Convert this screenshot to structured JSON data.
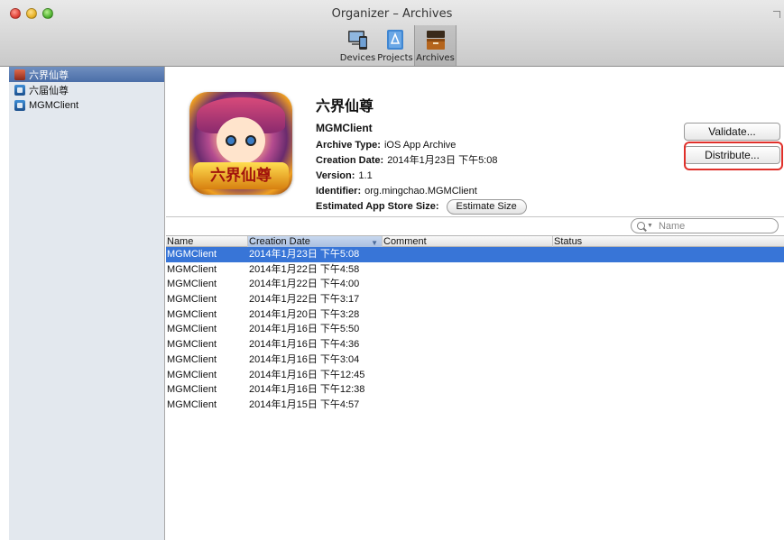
{
  "window": {
    "title": "Organizer – Archives",
    "toolbar": [
      {
        "label": "Devices",
        "icon": "devices-icon"
      },
      {
        "label": "Projects",
        "icon": "projects-icon"
      },
      {
        "label": "Archives",
        "icon": "archives-icon",
        "selected": true
      }
    ]
  },
  "sidebar": {
    "items": [
      {
        "label": "六界仙尊",
        "selected": true,
        "icon": "app-icon"
      },
      {
        "label": "六届仙尊",
        "icon": "project-icon"
      },
      {
        "label": "MGMClient",
        "icon": "project-icon"
      }
    ]
  },
  "details": {
    "app_name": "六界仙尊",
    "icon_text": "六界仙尊",
    "scheme": "MGMClient",
    "archive_type_label": "Archive Type:",
    "archive_type": "iOS App Archive",
    "creation_date_label": "Creation Date:",
    "creation_date": "2014年1月23日 下午5:08",
    "version_label": "Version:",
    "version": "1.1",
    "identifier_label": "Identifier:",
    "identifier": "org.mingchao.MGMClient",
    "size_label": "Estimated App Store Size:",
    "estimate_button": "Estimate Size",
    "validate_button": "Validate...",
    "distribute_button": "Distribute..."
  },
  "search": {
    "placeholder": "Name"
  },
  "table": {
    "columns": [
      "Name",
      "Creation Date",
      "Comment",
      "Status"
    ],
    "rows": [
      {
        "name": "MGMClient",
        "date": "2014年1月23日 下午5:08",
        "selected": true
      },
      {
        "name": "MGMClient",
        "date": "2014年1月22日 下午4:58"
      },
      {
        "name": "MGMClient",
        "date": "2014年1月22日 下午4:00"
      },
      {
        "name": "MGMClient",
        "date": "2014年1月22日 下午3:17"
      },
      {
        "name": "MGMClient",
        "date": "2014年1月20日 下午3:28"
      },
      {
        "name": "MGMClient",
        "date": "2014年1月16日 下午5:50"
      },
      {
        "name": "MGMClient",
        "date": "2014年1月16日 下午4:36"
      },
      {
        "name": "MGMClient",
        "date": "2014年1月16日 下午3:04"
      },
      {
        "name": "MGMClient",
        "date": "2014年1月16日 下午12:45"
      },
      {
        "name": "MGMClient",
        "date": "2014年1月16日 下午12:38"
      },
      {
        "name": "MGMClient",
        "date": "2014年1月15日 下午4:57"
      }
    ]
  },
  "colors": {
    "selection": "#3875d7",
    "highlight_box": "#e0302a",
    "sidebar_bg": "#e3e8ee"
  }
}
